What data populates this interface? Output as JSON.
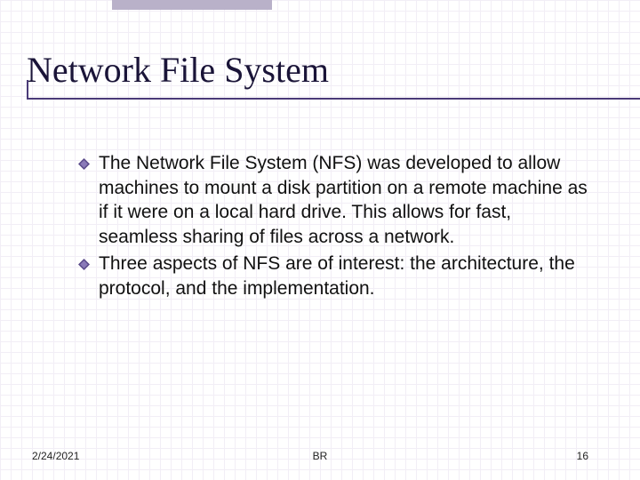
{
  "title": "Network File System",
  "bullets": [
    "The Network File System (NFS) was developed to allow machines to mount a disk partition on a remote machine as if it were on a local hard drive. This allows for fast, seamless sharing of files across a network.",
    "Three aspects of NFS are of interest: the architecture, the protocol, and the implementation."
  ],
  "footer": {
    "date": "2/24/2021",
    "author": "BR",
    "page": "16"
  },
  "colors": {
    "accent": "#4a3a78",
    "bullet_fill": "#6a5a9a"
  }
}
